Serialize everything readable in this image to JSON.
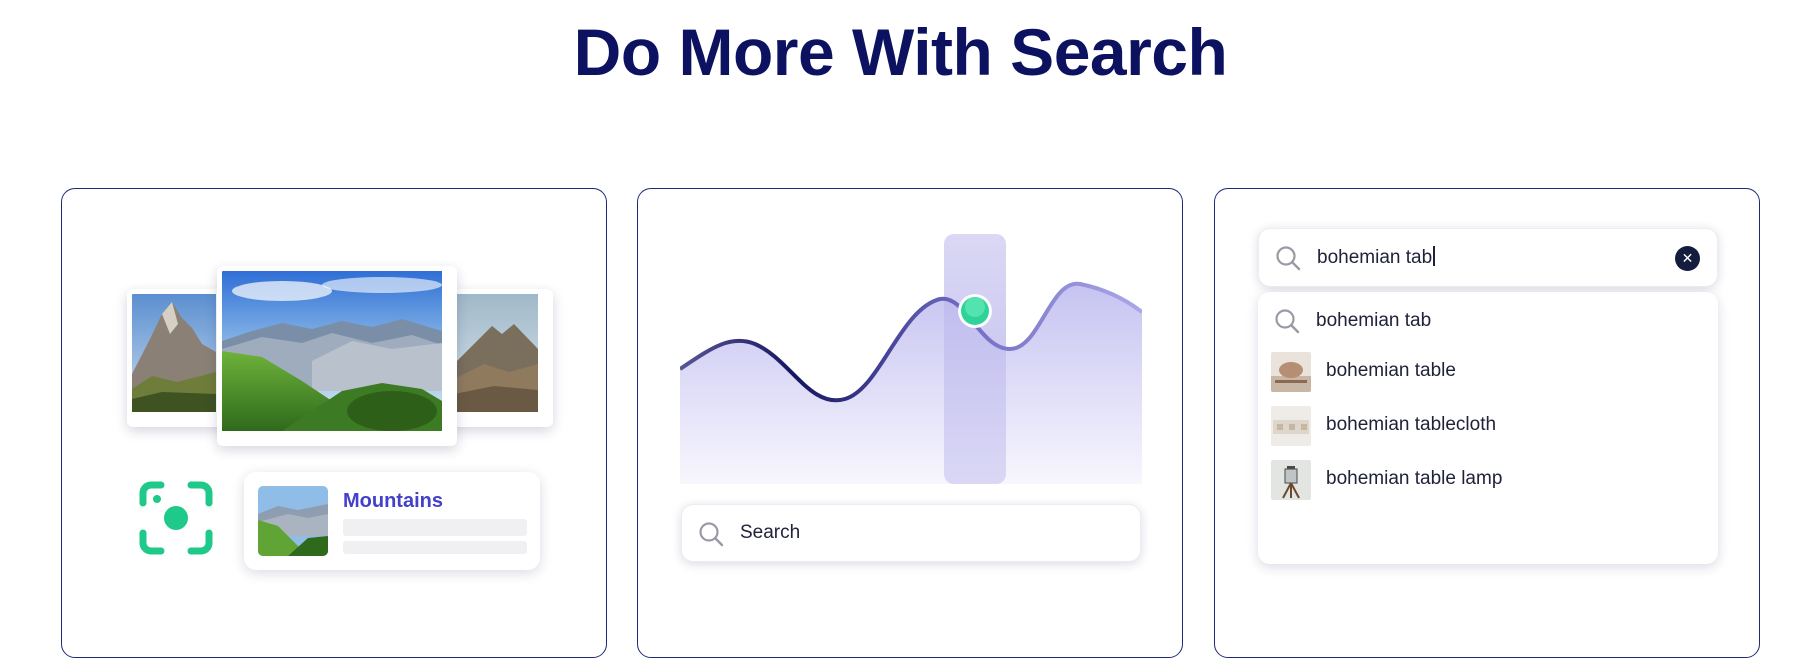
{
  "page": {
    "title": "Do More With Search"
  },
  "visual_search_card": {
    "result_title": "Mountains"
  },
  "trends_card": {
    "search_placeholder": "Search"
  },
  "autocomplete_card": {
    "query": "bohemian tab",
    "suggestions": [
      {
        "label": "bohemian tab",
        "icon": "search-icon"
      },
      {
        "label": "bohemian table",
        "icon": "product-thumbnail"
      },
      {
        "label": "bohemian tablecloth",
        "icon": "product-thumbnail"
      },
      {
        "label": "bohemian table lamp",
        "icon": "product-thumbnail"
      }
    ]
  },
  "colors": {
    "brand_navy": "#0c1260",
    "accent_purple": "#4440c9",
    "accent_green": "#1ec98a",
    "chart_fill": "#c9c6f2"
  }
}
